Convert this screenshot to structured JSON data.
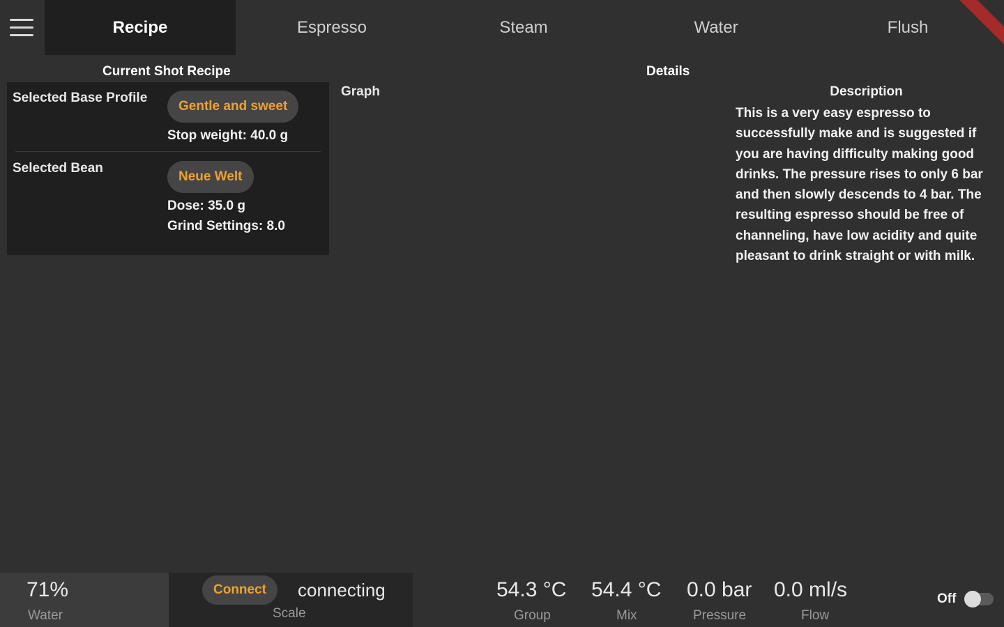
{
  "tabs": [
    {
      "label": "Recipe",
      "active": true
    },
    {
      "label": "Espresso",
      "active": false
    },
    {
      "label": "Steam",
      "active": false
    },
    {
      "label": "Water",
      "active": false
    },
    {
      "label": "Flush",
      "active": false
    }
  ],
  "sections": {
    "current_shot_recipe": "Current Shot Recipe",
    "details": "Details"
  },
  "recipe": {
    "base_profile_label": "Selected Base Profile",
    "base_profile_value": "Gentle and sweet",
    "stop_weight": "Stop weight: 40.0 g",
    "bean_label": "Selected Bean",
    "bean_value": "Neue Welt",
    "dose": "Dose: 35.0 g",
    "grind": "Grind Settings: 8.0"
  },
  "details": {
    "graph_label": "Graph",
    "description_title": "Description",
    "description_text": "This is a very easy espresso to successfully make and is suggested if you are having difficulty making good drinks.  The pressure rises to only 6 bar and then slowly descends to 4 bar.  The resulting espresso should be free of channeling, have low acidity and quite pleasant to drink straight or with milk."
  },
  "status": {
    "water_value": "71%",
    "water_label": "Water",
    "connect_label": "Connect",
    "scale_status": "connecting",
    "scale_label": "Scale",
    "group_value": "54.3 °C",
    "group_label": "Group",
    "mix_value": "54.4 °C",
    "mix_label": "Mix",
    "pressure_value": "0.0 bar",
    "pressure_label": "Pressure",
    "flow_value": "0.0 ml/s",
    "flow_label": "Flow",
    "toggle_label": "Off",
    "toggle_on": false
  },
  "colors": {
    "background": "#303030",
    "panel": "#1f1f1f",
    "accent": "#f0a030"
  },
  "icons": {
    "menu": "hamburger-menu-icon"
  }
}
